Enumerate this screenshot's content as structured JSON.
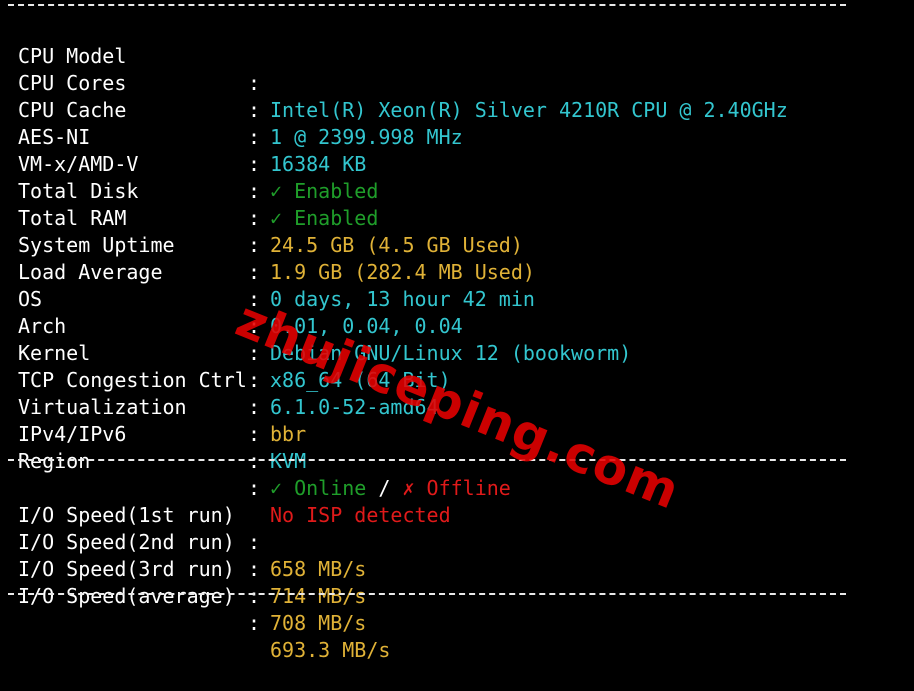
{
  "colors": {
    "background": "#000000",
    "label": "#ffffff",
    "cyan": "#33c6cf",
    "green": "#1f9e2a",
    "yellow": "#e0b237",
    "red": "#e01a1a"
  },
  "system_info": {
    "cpu_model": {
      "label": "CPU Model",
      "colon": ":",
      "value": "Intel(R) Xeon(R) Silver 4210R CPU @ 2.40GHz"
    },
    "cpu_cores": {
      "label": "CPU Cores",
      "colon": ":",
      "value": "1 @ 2399.998 MHz"
    },
    "cpu_cache": {
      "label": "CPU Cache",
      "colon": ":",
      "value": "16384 KB"
    },
    "aes_ni": {
      "label": "AES-NI",
      "colon": ":",
      "value": "✓ Enabled"
    },
    "vm_x": {
      "label": "VM-x/AMD-V",
      "colon": ":",
      "value": "✓ Enabled"
    },
    "total_disk": {
      "label": "Total Disk",
      "colon": ":",
      "value": "24.5 GB (4.5 GB Used)"
    },
    "total_ram": {
      "label": "Total RAM",
      "colon": ":",
      "value": "1.9 GB (282.4 MB Used)"
    },
    "uptime": {
      "label": "System Uptime",
      "colon": ":",
      "value": "0 days, 13 hour 42 min"
    },
    "load_average": {
      "label": "Load Average",
      "colon": ":",
      "value": "0.01, 0.04, 0.04"
    },
    "os": {
      "label": "OS",
      "colon": ":",
      "value": "Debian GNU/Linux 12 (bookworm)"
    },
    "arch": {
      "label": "Arch",
      "colon": ":",
      "value": "x86_64 (64 Bit)"
    },
    "kernel": {
      "label": "Kernel",
      "colon": ":",
      "value": "6.1.0-52-amd64"
    },
    "tcp_cc": {
      "label": "TCP Congestion Ctrl",
      "colon": ":",
      "value": "bbr"
    },
    "virtualization": {
      "label": "Virtualization",
      "colon": ":",
      "value": "KVM"
    },
    "ip": {
      "label": "IPv4/IPv6",
      "colon": ":",
      "ipv4": "✓ Online",
      "slash": "/",
      "ipv6": "✗ Offline"
    },
    "region": {
      "label": "Region",
      "colon": ":",
      "value": "No ISP detected"
    }
  },
  "io_speed": {
    "run1": {
      "label": "I/O Speed(1st run)",
      "colon": ":",
      "value": "658 MB/s"
    },
    "run2": {
      "label": "I/O Speed(2nd run)",
      "colon": ":",
      "value": "714 MB/s"
    },
    "run3": {
      "label": "I/O Speed(3rd run)",
      "colon": ":",
      "value": "708 MB/s"
    },
    "average": {
      "label": "I/O Speed(average)",
      "colon": ":",
      "value": "693.3 MB/s"
    }
  },
  "watermark": {
    "text": "zhujiceping.com"
  }
}
